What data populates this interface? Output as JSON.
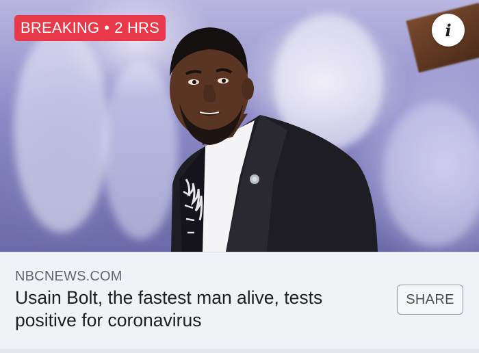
{
  "badge": {
    "label": "BREAKING",
    "separator": "•",
    "age": "2 HRS",
    "color": "#e8394a"
  },
  "info_button": {
    "glyph": "i",
    "icon": "info-icon"
  },
  "article": {
    "source": "NBCNEWS.COM",
    "headline": "Usain Bolt, the fastest man alive, tests positive for coronavirus"
  },
  "share_button": {
    "label": "SHARE"
  }
}
